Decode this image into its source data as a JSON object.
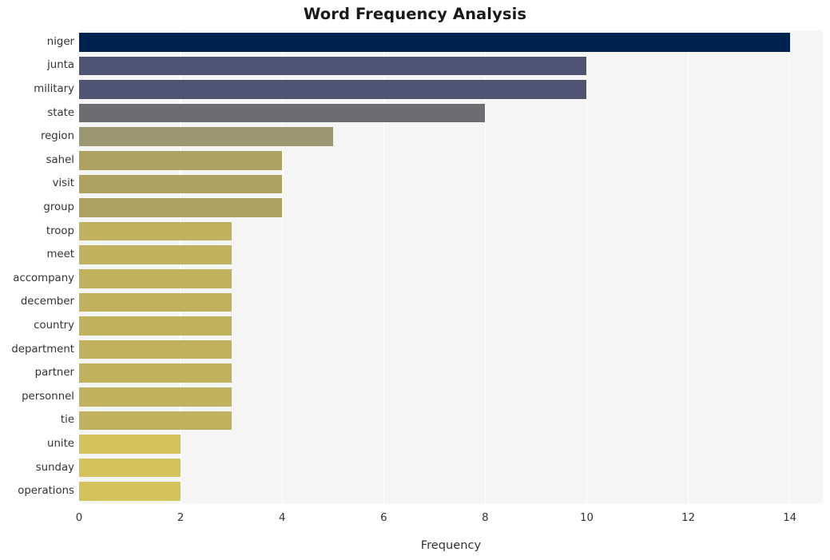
{
  "chart_data": {
    "type": "bar",
    "orientation": "horizontal",
    "title": "Word Frequency Analysis",
    "xlabel": "Frequency",
    "ylabel": "",
    "categories": [
      "niger",
      "junta",
      "military",
      "state",
      "region",
      "sahel",
      "visit",
      "group",
      "troop",
      "meet",
      "accompany",
      "december",
      "country",
      "department",
      "partner",
      "personnel",
      "tie",
      "unite",
      "sunday",
      "operations"
    ],
    "values": [
      14,
      10,
      10,
      8,
      5,
      4,
      4,
      4,
      3,
      3,
      3,
      3,
      3,
      3,
      3,
      3,
      3,
      2,
      2,
      2
    ],
    "bar_colors": [
      "#00224e",
      "#4d5572",
      "#4d5572",
      "#6b6d71",
      "#9c9673",
      "#aea262",
      "#aea262",
      "#aea262",
      "#c0b25c",
      "#c0b25c",
      "#c0b25c",
      "#c0b25c",
      "#c0b25c",
      "#c0b25c",
      "#c0b25c",
      "#c0b25c",
      "#c0b25c",
      "#d4c25a",
      "#d4c25a",
      "#d4c25a"
    ],
    "xlim": [
      0,
      14.65
    ],
    "xticks": [
      0,
      2,
      4,
      6,
      8,
      10,
      12,
      14
    ],
    "xticklabels": [
      "0",
      "2",
      "4",
      "6",
      "8",
      "10",
      "12",
      "14"
    ],
    "grid": true,
    "grid_axis": "x",
    "grid_color": "#ffffff",
    "plot_background": "#f5f5f5",
    "figure_background": "#ffffff",
    "legend": null,
    "colormap": "cividis"
  }
}
